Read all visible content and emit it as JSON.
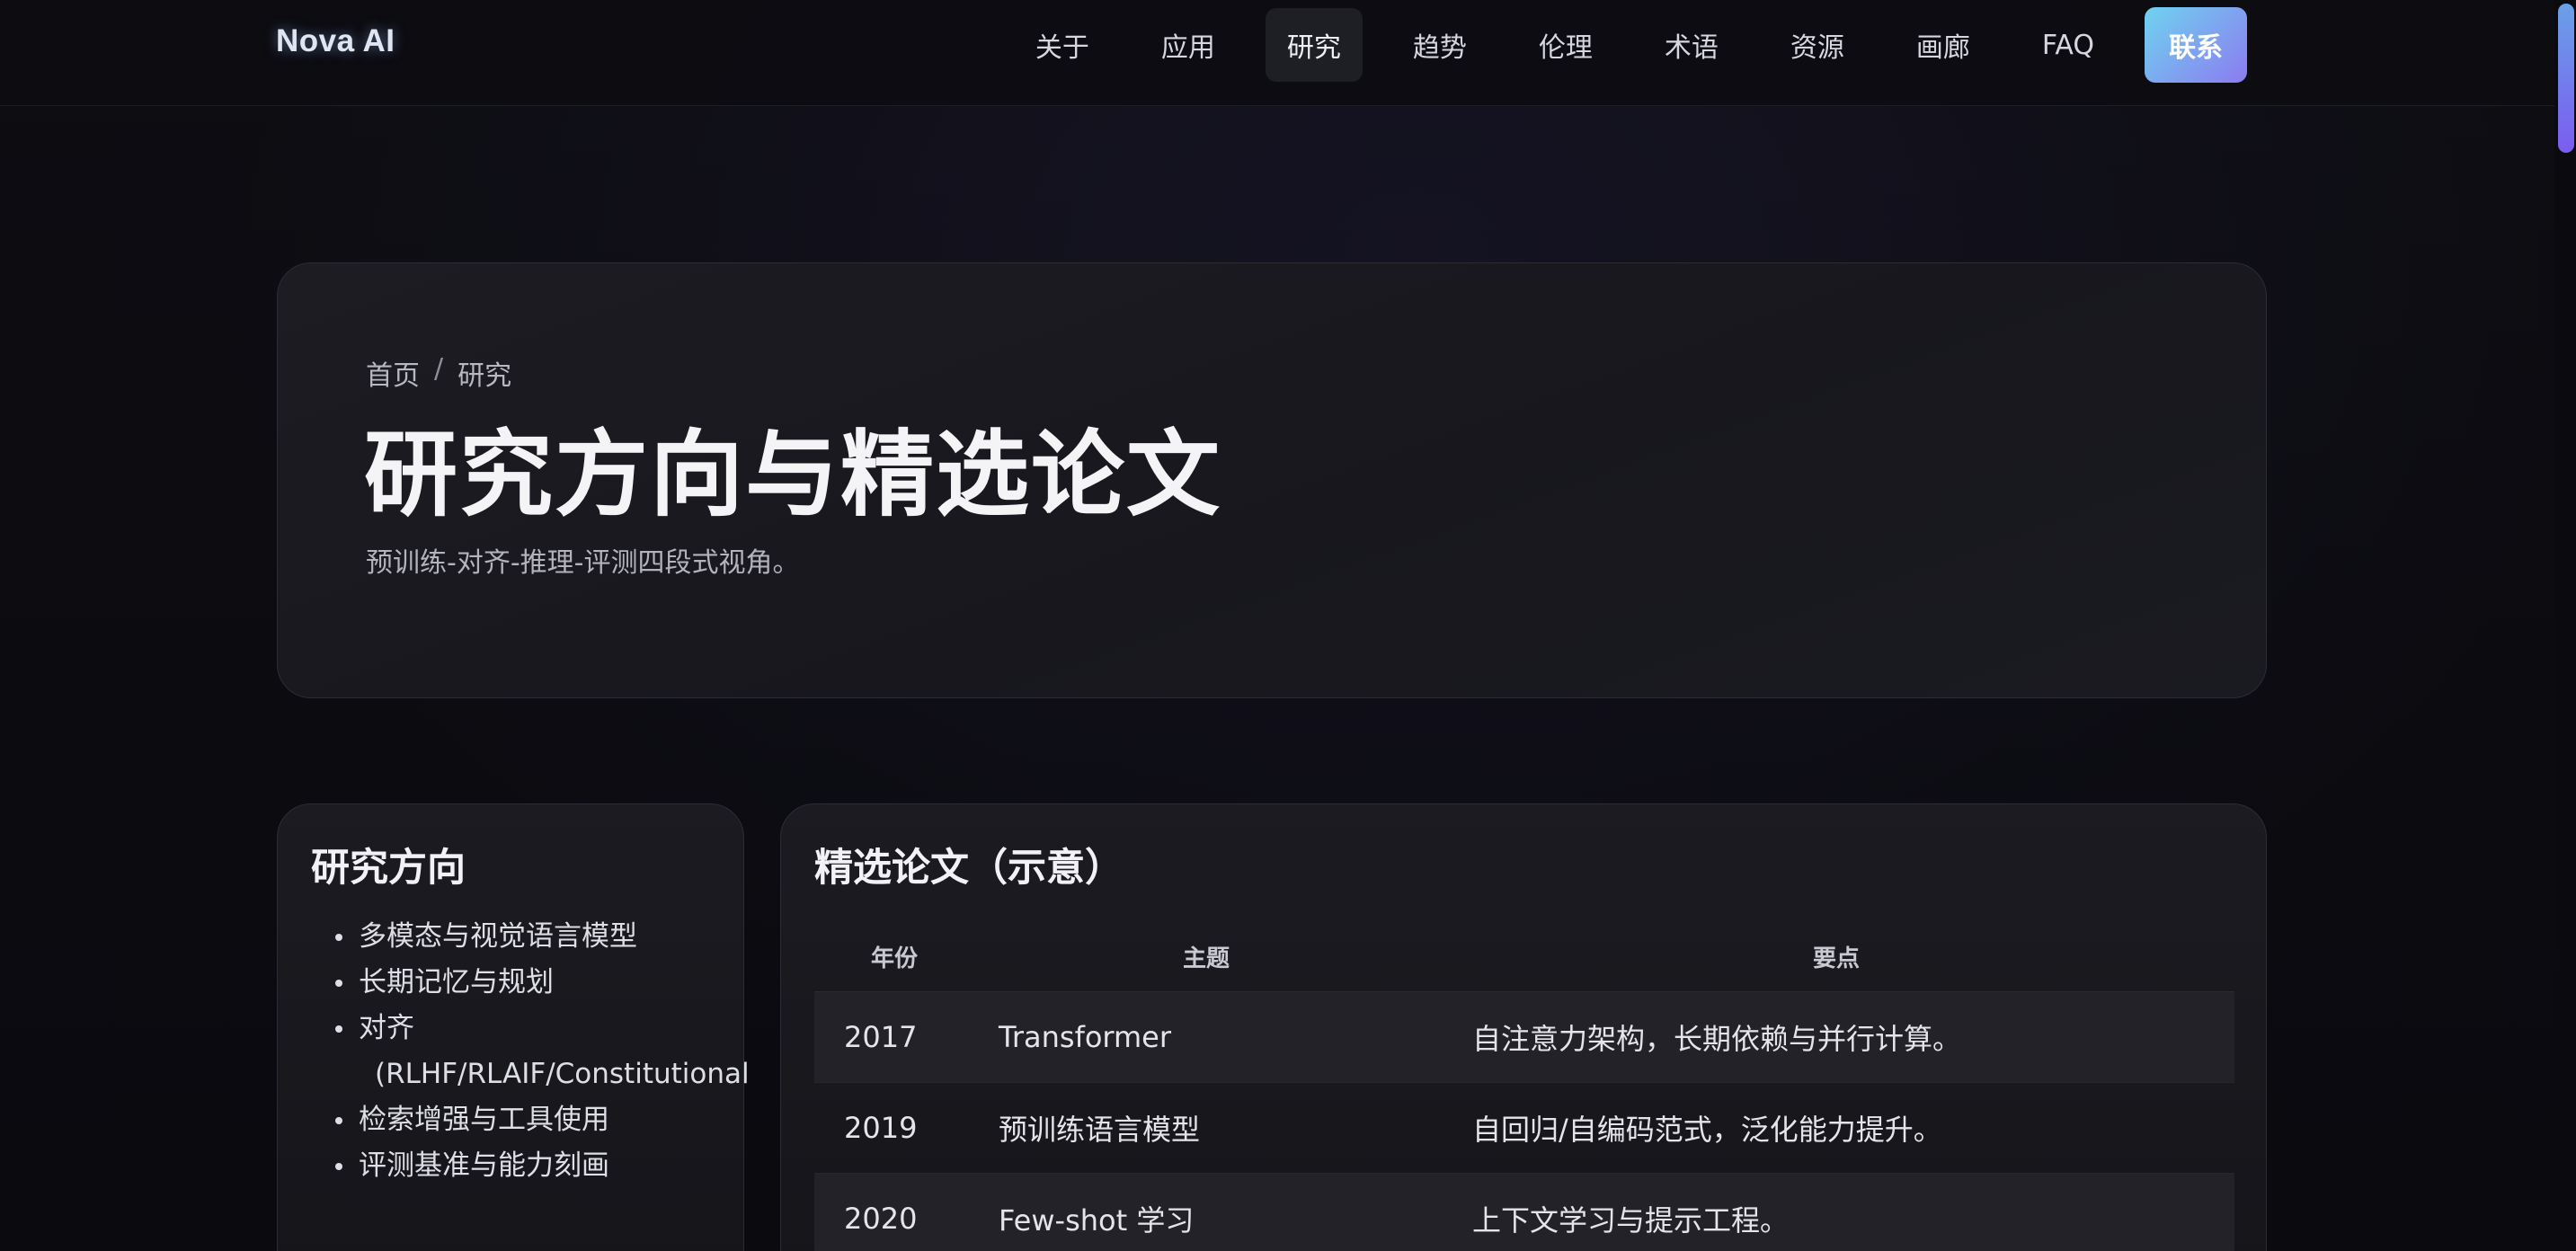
{
  "brand": "Nova AI",
  "nav": {
    "items": [
      {
        "label": "关于"
      },
      {
        "label": "应用"
      },
      {
        "label": "研究",
        "active": true
      },
      {
        "label": "趋势"
      },
      {
        "label": "伦理"
      },
      {
        "label": "术语"
      },
      {
        "label": "资源"
      },
      {
        "label": "画廊"
      },
      {
        "label": "FAQ"
      }
    ],
    "cta": "联系"
  },
  "hero": {
    "breadcrumb": {
      "home": "首页",
      "separator": "/",
      "current": "研究"
    },
    "title": "研究方向与精选论文",
    "subtitle": "预训练-对齐-推理-评测四段式视角。"
  },
  "directions": {
    "title": "研究方向",
    "items": [
      "多模态与视觉语言模型",
      "长期记忆与规划",
      "对齐",
      "检索增强与工具使用",
      "评测基准与能力刻画"
    ],
    "alignment_detail": "(RLHF/RLAIF/Constitutional"
  },
  "papers": {
    "title": "精选论文（示意）",
    "columns": {
      "year": "年份",
      "topic": "主题",
      "point": "要点"
    },
    "rows": [
      {
        "year": "2017",
        "topic": "Transformer",
        "point": "自注意力架构，长期依赖与并行计算。"
      },
      {
        "year": "2019",
        "topic": "预训练语言模型",
        "point": "自回归/自编码范式，泛化能力提升。"
      },
      {
        "year": "2020",
        "topic": "Few-shot 学习",
        "point": "上下文学习与提示工程。"
      }
    ]
  },
  "colors": {
    "background": "#0b0b10",
    "accent_start": "#6fd3f0",
    "accent_end": "#8c7bf0"
  }
}
